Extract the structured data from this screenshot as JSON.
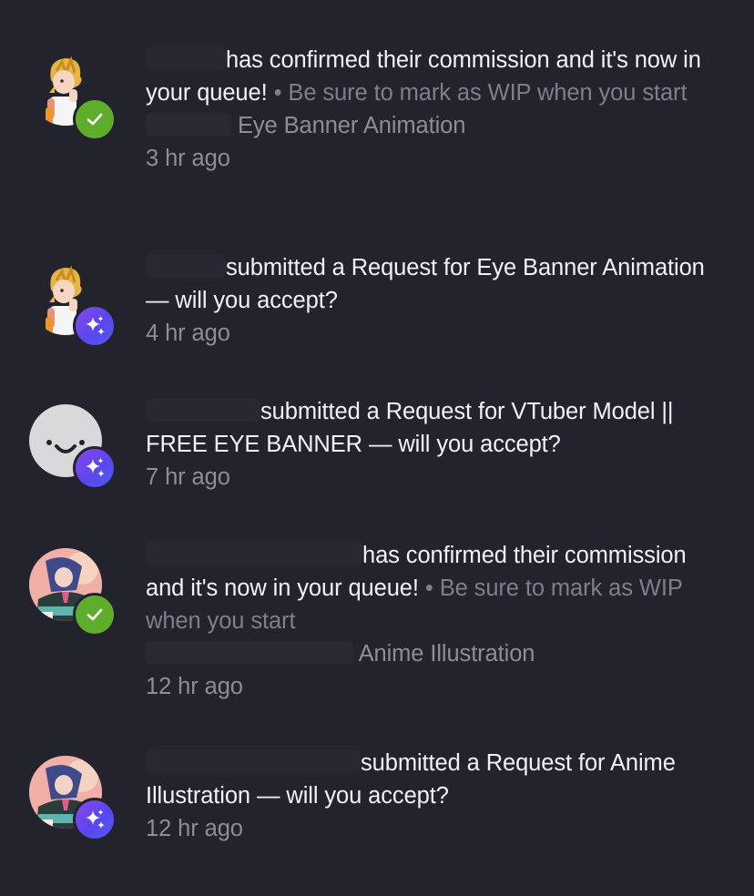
{
  "notifications": [
    {
      "type": "confirmed",
      "badge_icon": "check-icon",
      "avatar": "anime-character-avatar",
      "message": "has confirmed their commission and it's now in your queue!",
      "separator": "•",
      "hint": "Be sure to mark as WIP when you start",
      "service": "Eye Banner Animation",
      "time": "3 hr ago"
    },
    {
      "type": "request",
      "badge_icon": "sparkle-icon",
      "avatar": "anime-character-avatar",
      "message": "submitted a Request for Eye Banner Animation — will you accept?",
      "time": "4 hr ago"
    },
    {
      "type": "request",
      "badge_icon": "sparkle-icon",
      "avatar": "smiley-face-avatar",
      "message": "submitted a Request for VTuber Model || FREE EYE BANNER — will you accept?",
      "time": "7 hr ago"
    },
    {
      "type": "confirmed",
      "badge_icon": "check-icon",
      "avatar": "illustrated-girl-avatar",
      "message": "has confirmed their commission and it's now in your queue!",
      "separator": "•",
      "hint": "Be sure to mark as WIP when you start",
      "service": "Anime Illustration",
      "time": "12 hr ago"
    },
    {
      "type": "request",
      "badge_icon": "sparkle-icon",
      "avatar": "illustrated-girl-avatar",
      "message": "submitted a Request for Anime Illustration — will you accept?",
      "time": "12 hr ago"
    }
  ]
}
